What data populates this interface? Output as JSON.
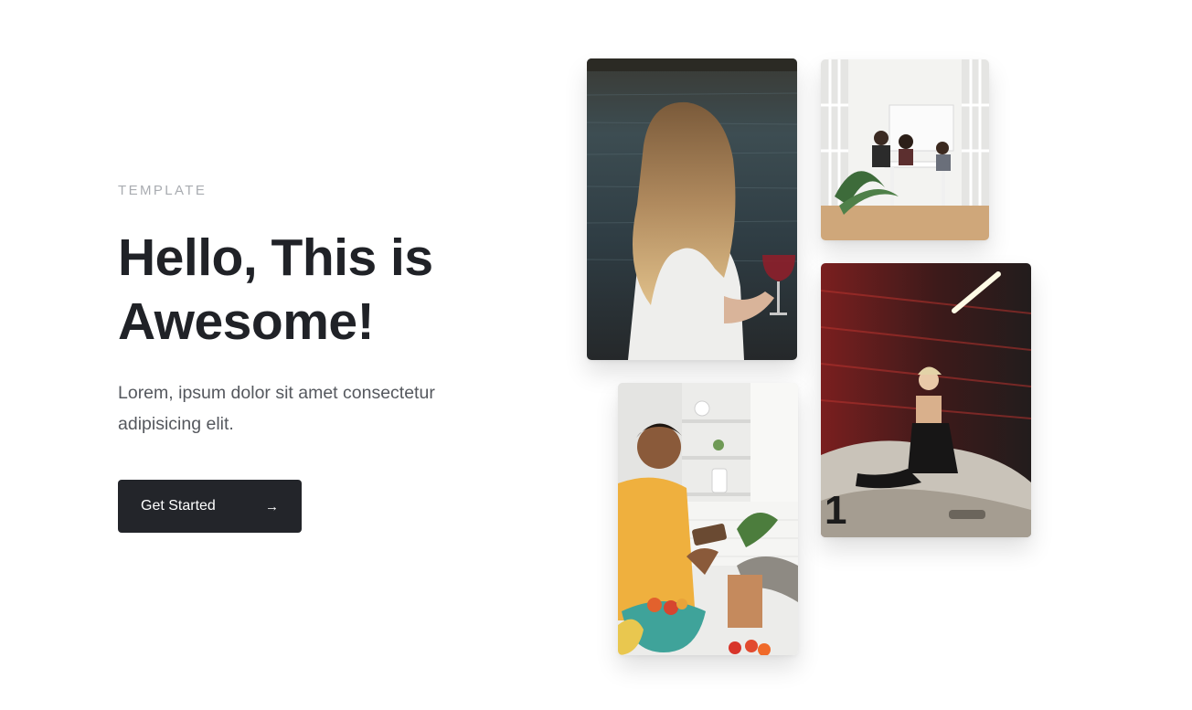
{
  "hero": {
    "eyebrow": "TEMPLATE",
    "title_line1": "Hello, This is",
    "title_line2": "Awesome!",
    "description": "Lorem, ipsum dolor sit amet consectetur adipisicing elit.",
    "cta_label": "Get Started",
    "cta_icon": "arrow-right-icon"
  },
  "gallery": {
    "photos": [
      {
        "name": "woman-with-wine-photo"
      },
      {
        "name": "family-dining-photo"
      },
      {
        "name": "woman-on-car-photo"
      },
      {
        "name": "man-in-kitchen-photo"
      }
    ]
  },
  "colors": {
    "background": "#ffffff",
    "heading": "#202227",
    "body_text": "#55585e",
    "eyebrow": "#a9acb1",
    "button_bg": "#23252a",
    "button_text": "#ffffff"
  }
}
